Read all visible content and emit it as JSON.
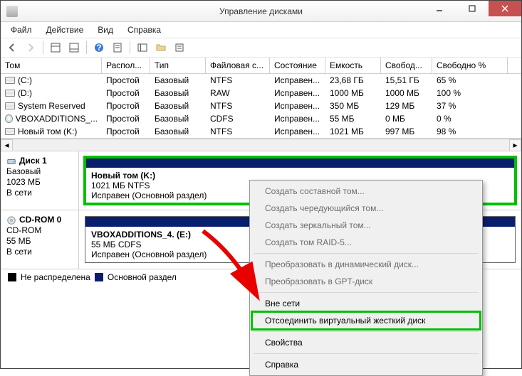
{
  "window": {
    "title": "Управление дисками"
  },
  "menu": {
    "file": "Файл",
    "action": "Действие",
    "view": "Вид",
    "help": "Справка"
  },
  "columns": [
    "Том",
    "Распол...",
    "Тип",
    "Файловая с...",
    "Состояние",
    "Емкость",
    "Свобод...",
    "Свободно %"
  ],
  "volumes": [
    {
      "icon": "hd",
      "name": "(C:)",
      "layout": "Простой",
      "type": "Базовый",
      "fs": "NTFS",
      "status": "Исправен...",
      "cap": "23,68 ГБ",
      "free": "15,51 ГБ",
      "pct": "65 %"
    },
    {
      "icon": "hd",
      "name": "(D:)",
      "layout": "Простой",
      "type": "Базовый",
      "fs": "RAW",
      "status": "Исправен...",
      "cap": "1000 МБ",
      "free": "1000 МБ",
      "pct": "100 %"
    },
    {
      "icon": "hd",
      "name": "System Reserved",
      "layout": "Простой",
      "type": "Базовый",
      "fs": "NTFS",
      "status": "Исправен...",
      "cap": "350 МБ",
      "free": "129 МБ",
      "pct": "37 %"
    },
    {
      "icon": "cd",
      "name": "VBOXADDITIONS_...",
      "layout": "Простой",
      "type": "Базовый",
      "fs": "CDFS",
      "status": "Исправен...",
      "cap": "55 МБ",
      "free": "0 МБ",
      "pct": "0 %"
    },
    {
      "icon": "hd",
      "name": "Новый том (K:)",
      "layout": "Простой",
      "type": "Базовый",
      "fs": "NTFS",
      "status": "Исправен...",
      "cap": "1021 МБ",
      "free": "997 МБ",
      "pct": "98 %"
    }
  ],
  "disks": [
    {
      "header": "Диск 1",
      "kind": "Базовый",
      "size": "1023 МБ",
      "status": "В сети",
      "icon": "hd",
      "partitions": [
        {
          "vol": "Новый том  (K:)",
          "sz": "1021 МБ NTFS",
          "st": "Исправен (Основной раздел)"
        }
      ],
      "highlight": true
    },
    {
      "header": "CD-ROM 0",
      "kind": "CD-ROM",
      "size": "55 МБ",
      "status": "В сети",
      "icon": "cd",
      "partitions": [
        {
          "vol": "VBOXADDITIONS_4.  (E:)",
          "sz": "55 МБ CDFS",
          "st": "Исправен (Основной раздел)"
        }
      ],
      "highlight": false
    }
  ],
  "legend": {
    "unalloc": "Не распределена",
    "primary": "Основной раздел"
  },
  "ctx": {
    "items": [
      {
        "label": "Создать составной том...",
        "enabled": false
      },
      {
        "label": "Создать чередующийся том...",
        "enabled": false
      },
      {
        "label": "Создать зеркальный том...",
        "enabled": false
      },
      {
        "label": "Создать том RAID-5...",
        "enabled": false
      },
      {
        "sep": true
      },
      {
        "label": "Преобразовать в динамический диск...",
        "enabled": false
      },
      {
        "label": "Преобразовать в GPT-диск",
        "enabled": false
      },
      {
        "sep": true
      },
      {
        "label": "Вне сети",
        "enabled": true
      },
      {
        "label": "Отсоединить виртуальный жесткий диск",
        "enabled": true,
        "hl": true
      },
      {
        "sep": true
      },
      {
        "label": "Свойства",
        "enabled": true
      },
      {
        "sep": true
      },
      {
        "label": "Справка",
        "enabled": true
      }
    ]
  }
}
